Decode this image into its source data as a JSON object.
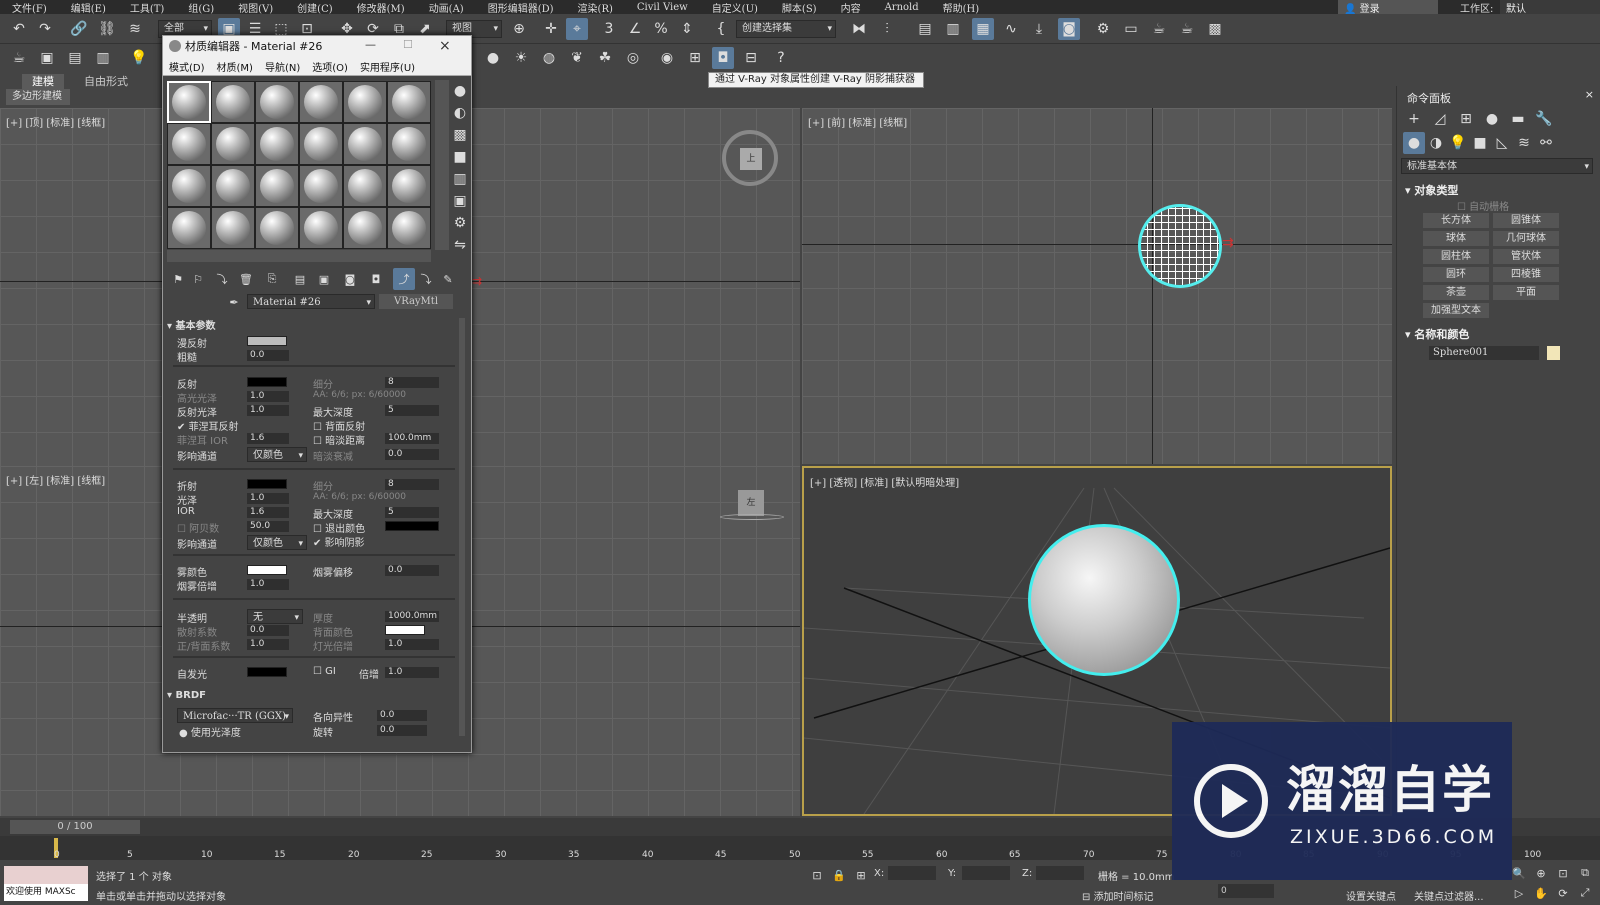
{
  "menu": [
    "文件(F)",
    "编辑(E)",
    "工具(T)",
    "组(G)",
    "视图(V)",
    "创建(C)",
    "修改器(M)",
    "动画(A)",
    "图形编辑器(D)",
    "渲染(R)",
    "Civil View",
    "自定义(U)",
    "脚本(S)",
    "内容",
    "Arnold",
    "帮助(H)"
  ],
  "login": "登录",
  "workspace_label": "工作区:",
  "workspace_value": "默认",
  "toolbar": {
    "filter": "全部",
    "refcoord": "视图",
    "selset": "创建选择集"
  },
  "tooltip": "通过 V-Ray 对象属性创建 V-Ray 阴影捕获器",
  "ribbon": {
    "tab1": "建模",
    "tab2": "自由形式",
    "poly": "多边形建模"
  },
  "viewports": {
    "tl": "[+] [顶] [标准] [线框]",
    "tr": "[+] [前] [标准] [线框]",
    "bl": "[+] [左] [标准] [线框]",
    "br": "[+] [透视] [标准] [默认明暗处理]",
    "gizmo_top": "上",
    "gizmo_left": "左"
  },
  "cmd": {
    "title": "命令面板",
    "category": "标准基本体",
    "objtype": "对象类型",
    "autogrid": "自动栅格",
    "buttons": [
      "长方体",
      "圆锥体",
      "球体",
      "几何球体",
      "圆柱体",
      "管状体",
      "圆环",
      "四棱锥",
      "茶壶",
      "平面",
      "加强型文本"
    ],
    "namecolor": "名称和颜色",
    "name": "Sphere001",
    "obj_color": "#f2e6b8"
  },
  "mat": {
    "title": "材质编辑器 - Material #26",
    "menu": [
      "模式(D)",
      "材质(M)",
      "导航(N)",
      "选项(O)",
      "实用程序(U)"
    ],
    "matname": "Material #26",
    "mattype": "VRayMtl",
    "basic": "基本参数",
    "diffuse": "漫反射",
    "rough": "粗糙",
    "rough_v": "0.0",
    "reflect": "反射",
    "subdiv": "细分",
    "subdiv_v": "8",
    "hgloss": "高光光泽",
    "hgloss_v": "1.0",
    "aa": "AA: 6/6; px: 6/60000",
    "rgloss": "反射光泽",
    "rgloss_v": "1.0",
    "maxdepth": "最大深度",
    "maxdepth_v": "5",
    "fresnel": "菲涅耳反射",
    "backreflect": "背面反射",
    "fresnelior": "菲涅耳 IOR",
    "fresnelior_v": "1.6",
    "dimdist": "暗淡距离",
    "dimdist_v": "100.0mm",
    "affect": "影响通道",
    "affect_v": "仅颜色",
    "dimfall": "暗淡衰减",
    "dimfall_v": "0.0",
    "refract": "折射",
    "rsubdiv_v": "8",
    "gloss": "光泽",
    "gloss_v": "1.0",
    "ior": "IOR",
    "ior_v": "1.6",
    "rmaxdepth_v": "5",
    "abbe": "阿贝数",
    "abbe_v": "50.0",
    "exitcolor": "退出颜色",
    "affectshadow": "影响阴影",
    "affect2_v": "仅颜色",
    "fog": "雾颜色",
    "fogbias": "烟雾偏移",
    "fogbias_v": "0.0",
    "fogmult": "烟雾倍增",
    "fogmult_v": "1.0",
    "translucent": "半透明",
    "translucent_v": "无",
    "thick": "厚度",
    "thick_v": "1000.0mm",
    "scatter": "散射系数",
    "scatter_v": "0.0",
    "backcolor": "背面颜色",
    "fb": "正/背面系数",
    "fb_v": "1.0",
    "lightmult": "灯光倍增",
    "lightmult_v": "1.0",
    "selfillum": "自发光",
    "gi": "GI",
    "mult": "倍增",
    "mult_v": "1.0",
    "brdf": "BRDF",
    "brdf_type": "Microfac···TR (GGX)",
    "aniso": "各向异性",
    "aniso_v": "0.0",
    "useglossy": "使用光泽度",
    "rot": "旋转",
    "rot_v": "0.0"
  },
  "timeline": {
    "frame": "0 / 100",
    "ticks": [
      "0",
      "5",
      "10",
      "15",
      "20",
      "25",
      "30",
      "35",
      "40",
      "45",
      "50",
      "55",
      "60",
      "65",
      "70",
      "75",
      "80",
      "85",
      "90",
      "95",
      "100"
    ]
  },
  "status": {
    "welcome": "欢迎使用 MAXSc",
    "selected": "选择了 1 个 对象",
    "hint": "单击或单击并拖动以选择对象",
    "x": "X:",
    "y": "Y:",
    "z": "Z:",
    "grid": "栅格 = 10.0mm",
    "addtime": "添加时间标记",
    "setkey": "设置关键点",
    "keyfilter": "关键点过滤器...",
    "frame_v": "0"
  },
  "watermark": {
    "title": "溜溜自学",
    "url": "ZIXUE.3D66.COM"
  }
}
